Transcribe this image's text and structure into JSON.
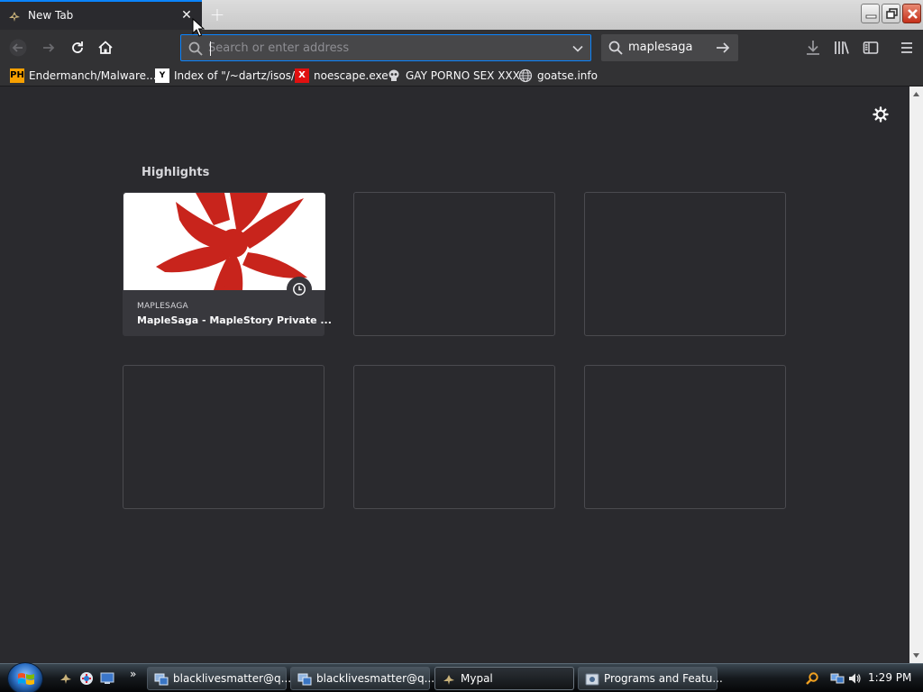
{
  "browser": {
    "tab": {
      "title": "New Tab",
      "close_symbol": "✕"
    },
    "new_tab_symbol": "+",
    "urlbar": {
      "placeholder": "Search or enter address",
      "value": ""
    },
    "searchbar": {
      "value": "maplesaga"
    }
  },
  "bookmarks": [
    {
      "label": "Endermanch/Malware...",
      "icon": "PH",
      "icon_name": "pornhub-favicon"
    },
    {
      "label": "Index of \"/~dartz/isos/\"",
      "icon": "Y",
      "icon_name": "site-favicon"
    },
    {
      "label": "noescape.exe",
      "icon": "X",
      "icon_name": "red-x-favicon"
    },
    {
      "label": "GAY PORNO SEX XXX",
      "icon": "",
      "icon_name": "skull-favicon"
    },
    {
      "label": "goatse.info",
      "icon": "",
      "icon_name": "globe-favicon"
    }
  ],
  "newtab": {
    "section_title": "Highlights",
    "cards": [
      {
        "host": "MAPLESAGA",
        "title": "MapleSaga - MapleStory Private ...",
        "filled": true
      }
    ]
  },
  "taskbar": {
    "buttons": [
      {
        "label": "blacklivesmatter@q...",
        "active": false
      },
      {
        "label": "blacklivesmatter@q...",
        "active": false
      },
      {
        "label": "Mypal",
        "active": true
      },
      {
        "label": "Programs and Featu...",
        "active": false
      }
    ],
    "quicklaunch_more": "»",
    "clock": "1:29 PM"
  },
  "colors": {
    "accent": "#0a84ff",
    "page_background": "#2a2a2e",
    "toolbar": "#323234",
    "maple_leaf": "#c8241c"
  }
}
